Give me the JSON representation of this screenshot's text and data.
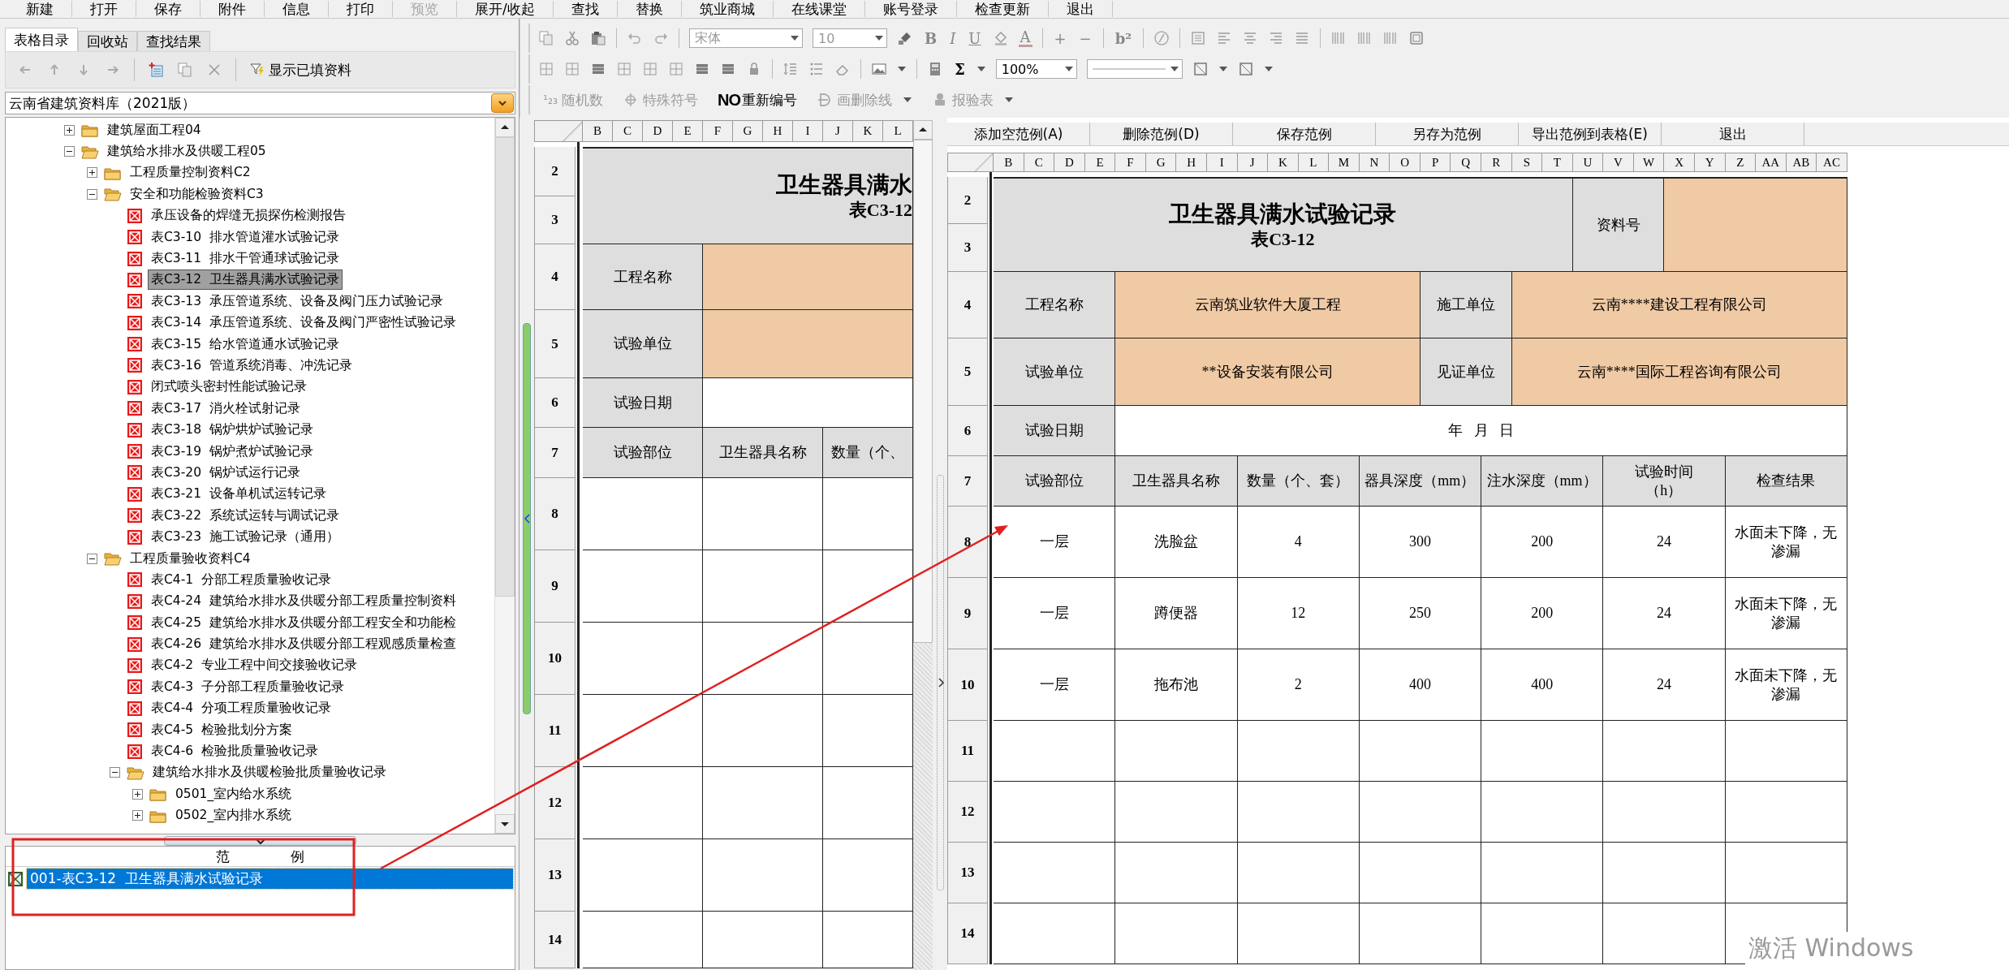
{
  "menu": [
    {
      "label": "新建",
      "disabled": false
    },
    {
      "label": "打开",
      "disabled": false
    },
    {
      "label": "保存",
      "disabled": false
    },
    {
      "label": "附件",
      "disabled": false
    },
    {
      "label": "信息",
      "disabled": false
    },
    {
      "label": "打印",
      "disabled": false
    },
    {
      "label": "预览",
      "disabled": true
    },
    {
      "label": "展开/收起",
      "disabled": false
    },
    {
      "label": "查找",
      "disabled": false
    },
    {
      "label": "替换",
      "disabled": false
    },
    {
      "label": "筑业商城",
      "disabled": false
    },
    {
      "label": "在线课堂",
      "disabled": false
    },
    {
      "label": "账号登录",
      "disabled": false
    },
    {
      "label": "检查更新",
      "disabled": false
    },
    {
      "label": "退出",
      "disabled": false
    }
  ],
  "left_panel": {
    "tabs": [
      {
        "label": "表格目录",
        "selected": true
      },
      {
        "label": "回收站",
        "selected": false
      },
      {
        "label": "查找结果",
        "selected": false
      }
    ],
    "show_filled": "显示已填资料",
    "library": "云南省建筑资料库（2021版）",
    "tree": [
      {
        "label": "建筑屋面工程04",
        "kind": "folder",
        "expanded": false,
        "selected": false
      },
      {
        "label": "建筑给水排水及供暖工程05",
        "kind": "folder",
        "expanded": true,
        "selected": false,
        "children": [
          {
            "label": "工程质量控制资料C2",
            "kind": "folder",
            "expanded": false,
            "selected": false
          },
          {
            "label": "安全和功能检验资料C3",
            "kind": "folder",
            "expanded": true,
            "selected": false,
            "children": [
              {
                "label": "承压设备的焊缝无损探伤检测报告",
                "kind": "doc",
                "selected": false
              },
              {
                "label": "表C3-10  排水管道灌水试验记录",
                "kind": "doc",
                "selected": false
              },
              {
                "label": "表C3-11  排水干管通球试验记录",
                "kind": "doc",
                "selected": false
              },
              {
                "label": "表C3-12  卫生器具满水试验记录",
                "kind": "doc",
                "selected": true
              },
              {
                "label": "表C3-13  承压管道系统、设备及阀门压力试验记录",
                "kind": "doc",
                "selected": false
              },
              {
                "label": "表C3-14  承压管道系统、设备及阀门严密性试验记录",
                "kind": "doc",
                "selected": false
              },
              {
                "label": "表C3-15  给水管道通水试验记录",
                "kind": "doc",
                "selected": false
              },
              {
                "label": "表C3-16  管道系统消毒、冲洗记录",
                "kind": "doc",
                "selected": false
              },
              {
                "label": "闭式喷头密封性能试验记录",
                "kind": "doc",
                "selected": false
              },
              {
                "label": "表C3-17  消火栓试射记录",
                "kind": "doc",
                "selected": false
              },
              {
                "label": "表C3-18  锅炉烘炉试验记录",
                "kind": "doc",
                "selected": false
              },
              {
                "label": "表C3-19  锅炉煮炉试验记录",
                "kind": "doc",
                "selected": false
              },
              {
                "label": "表C3-20  锅炉试运行记录",
                "kind": "doc",
                "selected": false
              },
              {
                "label": "表C3-21  设备单机试运转记录",
                "kind": "doc",
                "selected": false
              },
              {
                "label": "表C3-22  系统试运转与调试记录",
                "kind": "doc",
                "selected": false
              },
              {
                "label": "表C3-23  施工试验记录（通用）",
                "kind": "doc",
                "selected": false
              }
            ]
          },
          {
            "label": "工程质量验收资料C4",
            "kind": "folder",
            "expanded": true,
            "selected": false,
            "children": [
              {
                "label": "表C4-1  分部工程质量验收记录",
                "kind": "doc",
                "selected": false
              },
              {
                "label": "表C4-24  建筑给水排水及供暖分部工程质量控制资料",
                "kind": "doc",
                "selected": false
              },
              {
                "label": "表C4-25  建筑给水排水及供暖分部工程安全和功能检",
                "kind": "doc",
                "selected": false
              },
              {
                "label": "表C4-26  建筑给水排水及供暖分部工程观感质量检查",
                "kind": "doc",
                "selected": false
              },
              {
                "label": "表C4-2  专业工程中间交接验收记录",
                "kind": "doc",
                "selected": false
              },
              {
                "label": "表C4-3  子分部工程质量验收记录",
                "kind": "doc",
                "selected": false
              },
              {
                "label": "表C4-4  分项工程质量验收记录",
                "kind": "doc",
                "selected": false
              },
              {
                "label": "表C4-5  检验批划分方案",
                "kind": "doc",
                "selected": false
              },
              {
                "label": "表C4-6  检验批质量验收记录",
                "kind": "doc",
                "selected": false
              },
              {
                "label": "建筑给水排水及供暖检验批质量验收记录",
                "kind": "folder",
                "expanded": true,
                "selected": false,
                "children": [
                  {
                    "label": "0501_室内给水系统",
                    "kind": "folder",
                    "expanded": false,
                    "selected": false
                  },
                  {
                    "label": "0502_室内排水系统",
                    "kind": "folder",
                    "expanded": false,
                    "selected": false
                  }
                ]
              }
            ]
          }
        ]
      }
    ],
    "examples": {
      "header": "范 例",
      "items": [
        {
          "label": "001-表C3-12  卫生器具满水试验记录",
          "selected": true
        }
      ]
    }
  },
  "editor_toolbar": {
    "font": "宋体",
    "size": "10",
    "bold": "B",
    "italic": "I",
    "underline": "U",
    "font_color": "A",
    "grow": "+",
    "shrink": "−",
    "superscript": "b²",
    "sum": "Σ",
    "zoom": "100%",
    "buttons": [
      {
        "kind": "random",
        "prefix": "¹₂₃",
        "label": "随机数",
        "disabled": true,
        "dropdown": false
      },
      {
        "kind": "symbol",
        "label": "特殊符号",
        "disabled": true,
        "dropdown": false
      },
      {
        "kind": "renumber",
        "prefix": "NO",
        "label": "重新编号",
        "disabled": false,
        "dropdown": false
      },
      {
        "kind": "strike",
        "label": "画删除线",
        "disabled": true,
        "dropdown": true
      },
      {
        "kind": "report",
        "label": "报验表",
        "disabled": true,
        "dropdown": true
      }
    ]
  },
  "example_actions": [
    "添加空范例(A)",
    "删除范例(D)",
    "保存范例",
    "另存为范例",
    "导出范例到表格(E)",
    "退出"
  ],
  "middle_sheet": {
    "column_letters": [
      "B",
      "C",
      "D",
      "E",
      "F",
      "G",
      "H",
      "I",
      "J",
      "K",
      "L"
    ],
    "row_numbers": [
      "2",
      "3",
      "4",
      "5",
      "6",
      "7",
      "8",
      "9",
      "10",
      "11",
      "12",
      "13",
      "14"
    ],
    "title": "卫生器具满水",
    "code": "表C3-12",
    "labels": [
      "工程名称",
      "试验单位",
      "试验日期"
    ],
    "table_headers": [
      "试验部位",
      "卫生器具名称",
      "数量（个、"
    ]
  },
  "right_sheet": {
    "column_letters": [
      "B",
      "C",
      "D",
      "E",
      "F",
      "G",
      "H",
      "I",
      "J",
      "K",
      "L",
      "M",
      "N",
      "O",
      "P",
      "Q",
      "R",
      "S",
      "T",
      "U",
      "V",
      "W",
      "X",
      "Y",
      "Z",
      "AA",
      "AB",
      "AC"
    ],
    "row_numbers": [
      "2",
      "3",
      "4",
      "5",
      "6",
      "7",
      "8",
      "9",
      "10",
      "11",
      "12",
      "13",
      "14"
    ],
    "title": "卫生器具满水试验记录",
    "code": "表C3-12",
    "doc_no_label": "资料号",
    "info_rows": [
      {
        "label": "工程名称",
        "value": "云南筑业软件大厦工程",
        "label2": "施工单位",
        "value2": "云南****建设工程有限公司"
      },
      {
        "label": "试验单位",
        "value": "**设备安装有限公司",
        "label2": "见证单位",
        "value2": "云南****国际工程咨询有限公司"
      }
    ],
    "date_label": "试验日期",
    "date_value": "年   月   日",
    "table_headers": [
      "试验部位",
      "卫生器具名称",
      "数量（个、套）",
      "器具深度（mm）",
      "注水深度（mm）",
      "试验时间（h）",
      "检查结果"
    ],
    "rows": [
      [
        "一层",
        "洗脸盆",
        "4",
        "300",
        "200",
        "24",
        "水面未下降，无渗漏"
      ],
      [
        "一层",
        "蹲便器",
        "12",
        "250",
        "200",
        "24",
        "水面未下降，无渗漏"
      ],
      [
        "一层",
        "拖布池",
        "2",
        "400",
        "400",
        "24",
        "水面未下降，无渗漏"
      ]
    ]
  },
  "os_watermark": "激活 Windows"
}
